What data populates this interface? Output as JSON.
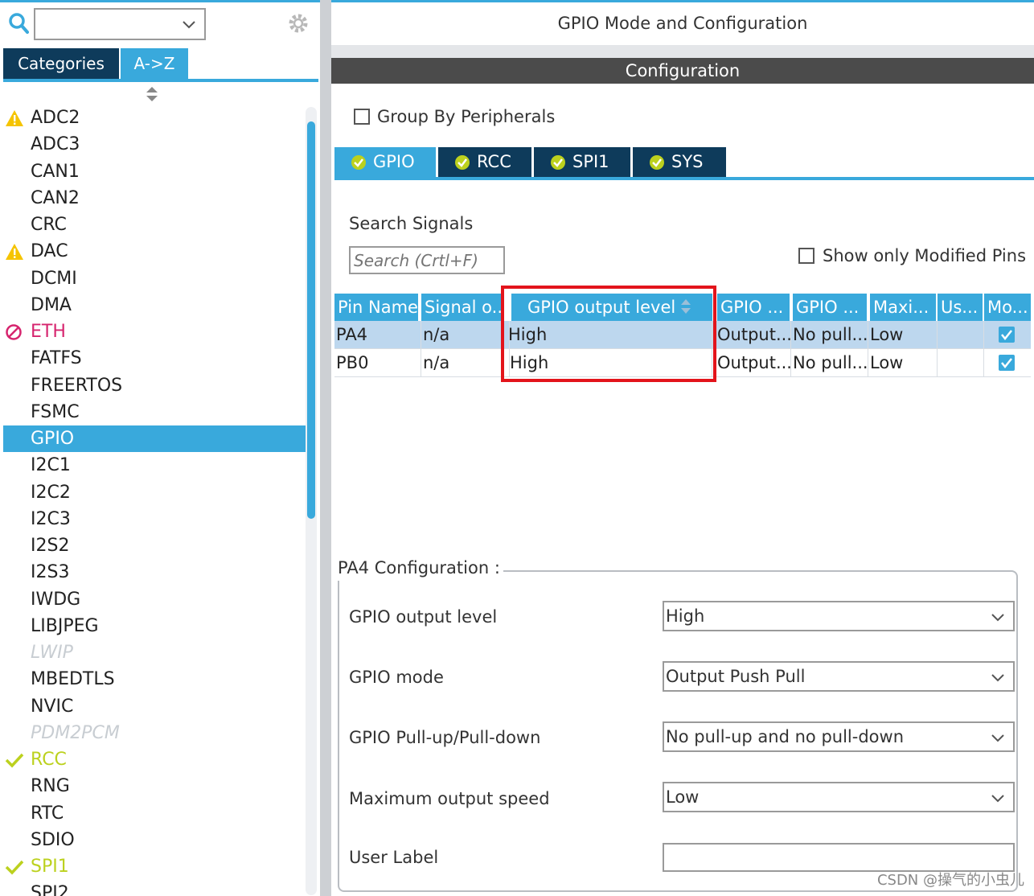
{
  "left": {
    "tabs": [
      "Categories",
      "A->Z"
    ],
    "active_tab": "A->Z",
    "peripherals": [
      {
        "label": "ADC2",
        "status": "warning"
      },
      {
        "label": "ADC3",
        "status": "none"
      },
      {
        "label": "CAN1",
        "status": "none"
      },
      {
        "label": "CAN2",
        "status": "none"
      },
      {
        "label": "CRC",
        "status": "none"
      },
      {
        "label": "DAC",
        "status": "warning"
      },
      {
        "label": "DCMI",
        "status": "none"
      },
      {
        "label": "DMA",
        "status": "none"
      },
      {
        "label": "ETH",
        "status": "blocked"
      },
      {
        "label": "FATFS",
        "status": "none"
      },
      {
        "label": "FREERTOS",
        "status": "none"
      },
      {
        "label": "FSMC",
        "status": "none"
      },
      {
        "label": "GPIO",
        "status": "selected"
      },
      {
        "label": "I2C1",
        "status": "none"
      },
      {
        "label": "I2C2",
        "status": "none"
      },
      {
        "label": "I2C3",
        "status": "none"
      },
      {
        "label": "I2S2",
        "status": "none"
      },
      {
        "label": "I2S3",
        "status": "none"
      },
      {
        "label": "IWDG",
        "status": "none"
      },
      {
        "label": "LIBJPEG",
        "status": "none"
      },
      {
        "label": "LWIP",
        "status": "disabled"
      },
      {
        "label": "MBEDTLS",
        "status": "none"
      },
      {
        "label": "NVIC",
        "status": "none"
      },
      {
        "label": "PDM2PCM",
        "status": "disabled"
      },
      {
        "label": "RCC",
        "status": "configured"
      },
      {
        "label": "RNG",
        "status": "none"
      },
      {
        "label": "RTC",
        "status": "none"
      },
      {
        "label": "SDIO",
        "status": "none"
      },
      {
        "label": "SPI1",
        "status": "configured"
      },
      {
        "label": "SPI2",
        "status": "none"
      }
    ]
  },
  "right": {
    "title": "GPIO Mode and Configuration",
    "config_header": "Configuration",
    "group_by_label": "Group By Peripherals",
    "tabs": [
      "GPIO",
      "RCC",
      "SPI1",
      "SYS"
    ],
    "search_label": "Search Signals",
    "search_placeholder": "Search (Crtl+F)",
    "show_modified_label": "Show only Modified Pins",
    "table": {
      "headers": [
        "Pin Name",
        "Signal o...",
        "GPIO output level",
        "GPIO ...",
        "GPIO ...",
        "Maxi...",
        "Us...",
        "Mo..."
      ],
      "rows": [
        {
          "pin": "PA4",
          "signal": "n/a",
          "level": "High",
          "mode": "Output...",
          "pull": "No pull...",
          "speed": "Low",
          "user": "",
          "modified": true
        },
        {
          "pin": "PB0",
          "signal": "n/a",
          "level": "High",
          "mode": "Output...",
          "pull": "No pull...",
          "speed": "Low",
          "user": "",
          "modified": true
        }
      ]
    },
    "pa4": {
      "legend": "PA4 Configuration :",
      "fields": [
        {
          "label": "GPIO output level",
          "value": "High"
        },
        {
          "label": "GPIO mode",
          "value": "Output Push Pull"
        },
        {
          "label": "GPIO Pull-up/Pull-down",
          "value": "No pull-up and no pull-down"
        },
        {
          "label": "Maximum output speed",
          "value": "Low"
        }
      ],
      "user_label": "User Label",
      "user_label_value": ""
    }
  },
  "watermark": "CSDN @操气的小虫儿",
  "colors": {
    "accent": "#39a9dc",
    "dark_tab": "#0e3b5b",
    "highlight": "#e3141b",
    "warning": "#f5c400",
    "configured": "#bcd11e",
    "blocked": "#d6246e"
  }
}
